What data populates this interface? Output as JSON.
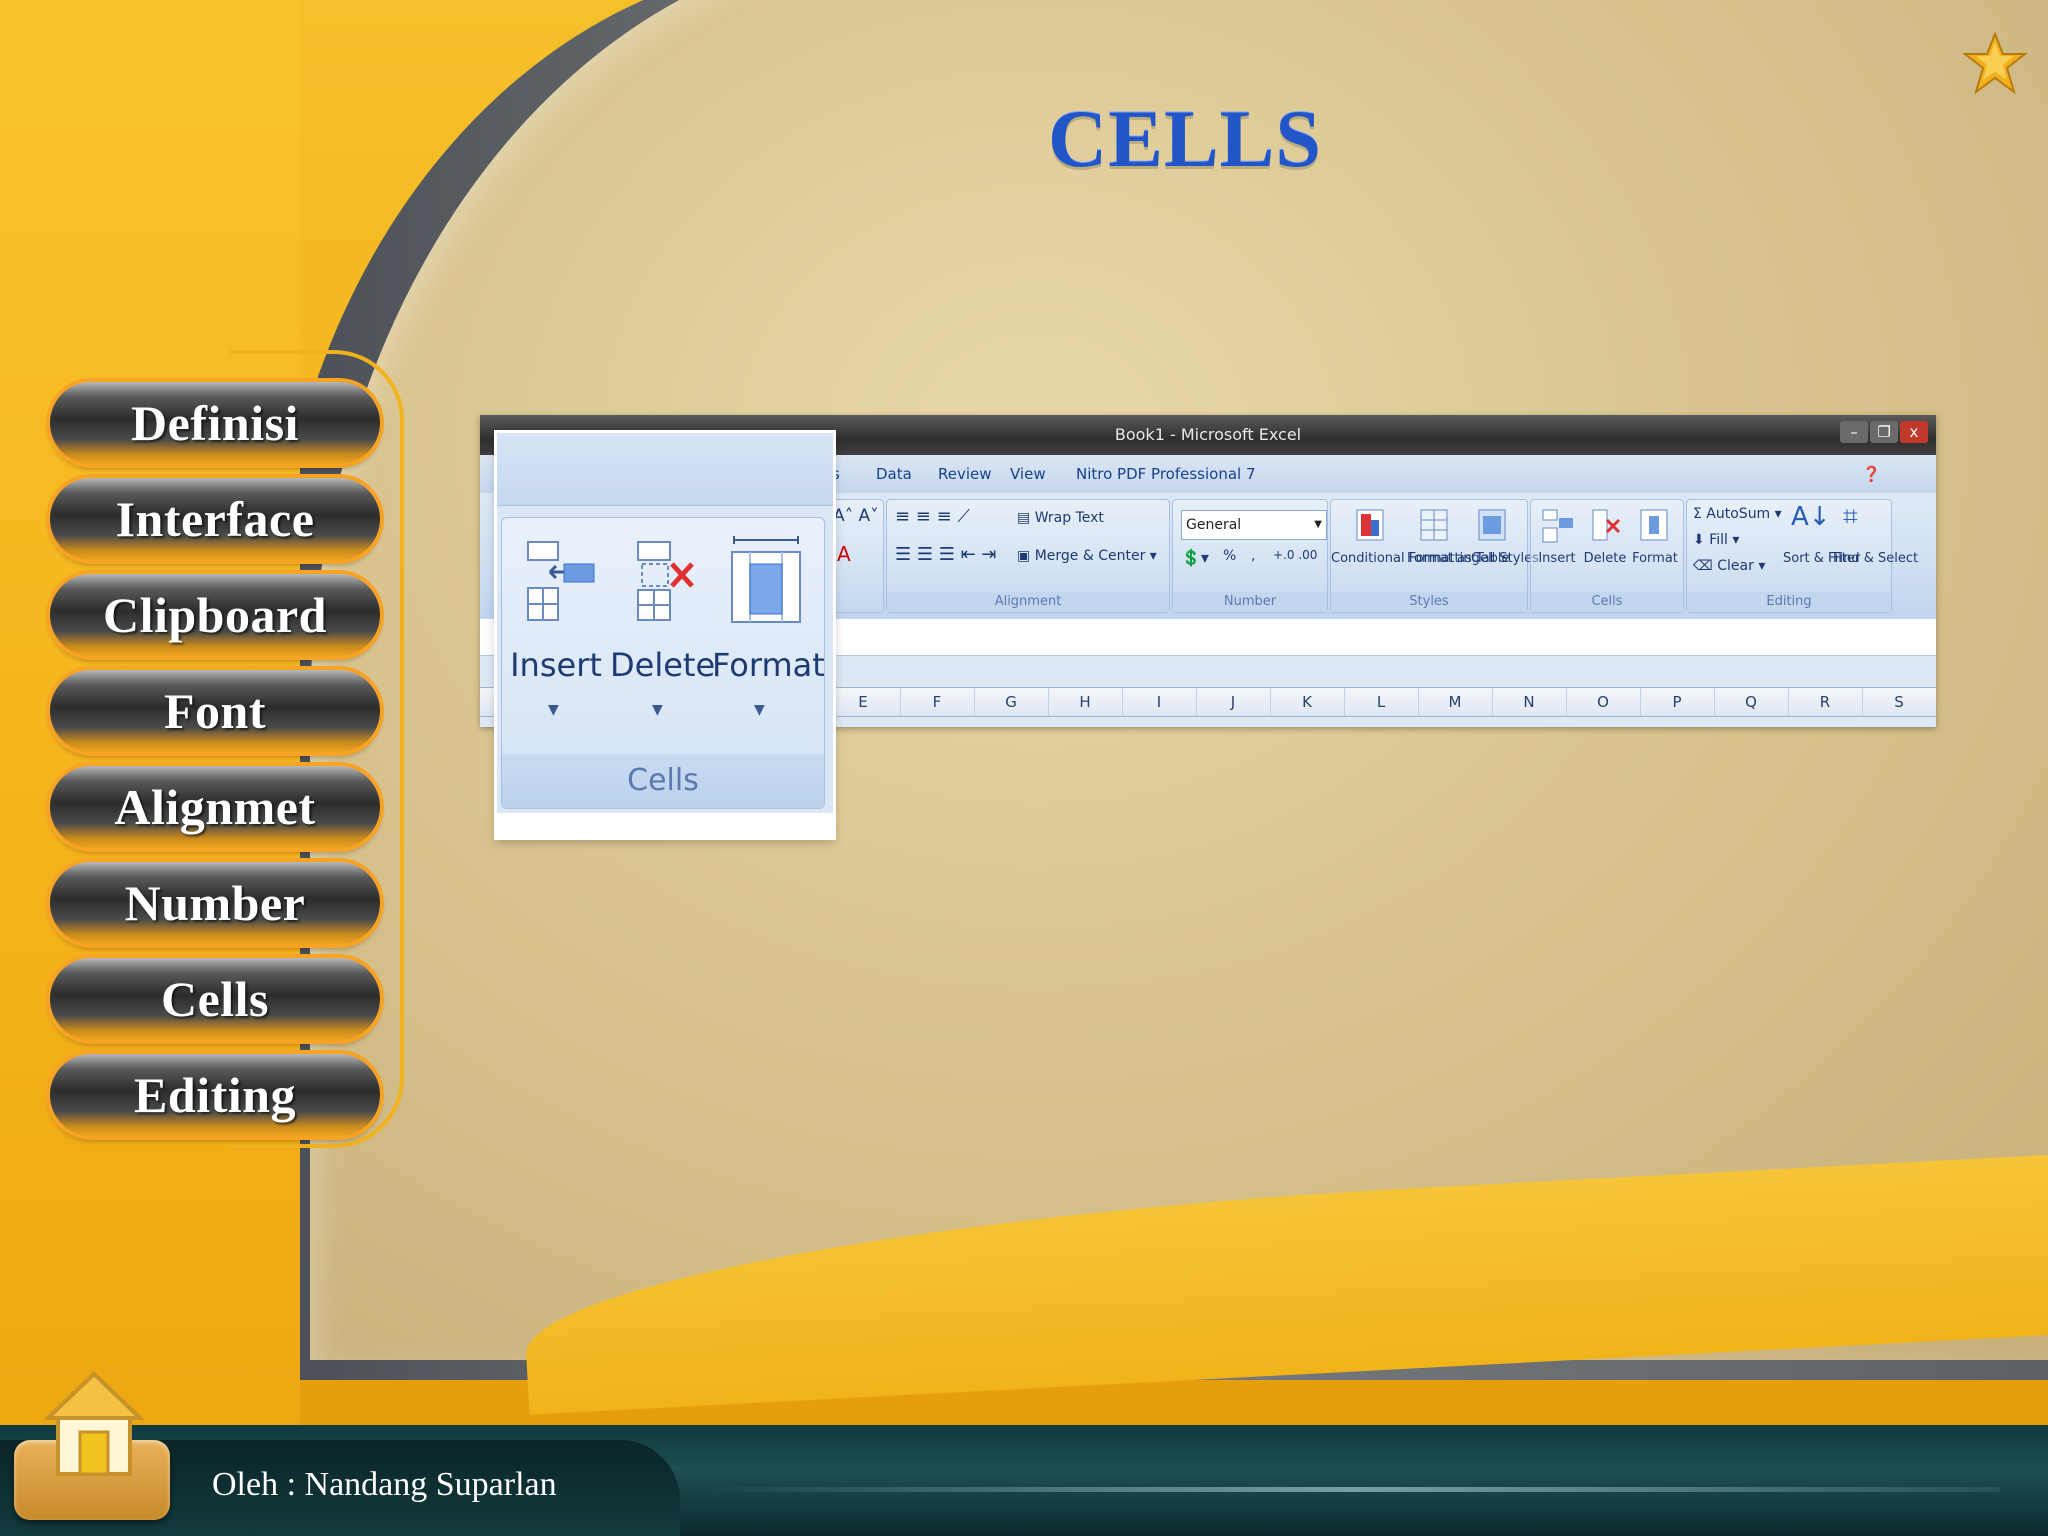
{
  "slide": {
    "title": "CELLS",
    "author": "Oleh : Nandang Suparlan"
  },
  "nav": {
    "items": [
      {
        "label": "Definisi"
      },
      {
        "label": "Interface"
      },
      {
        "label": "Clipboard"
      },
      {
        "label": "Font"
      },
      {
        "label": "Alignmet"
      },
      {
        "label": "Number"
      },
      {
        "label": "Cells"
      },
      {
        "label": "Editing"
      }
    ]
  },
  "excel": {
    "window_title": "Book1 - Microsoft Excel",
    "tabs": [
      "s",
      "Data",
      "Review",
      "View",
      "Nitro PDF Professional 7"
    ],
    "alignment": {
      "wrap_text": "Wrap Text",
      "merge_center": "Merge & Center",
      "group": "Alignment"
    },
    "number": {
      "format": "General",
      "percent": "%",
      "comma": ",",
      "group": "Number"
    },
    "styles": {
      "conditional": "Conditional Formatting",
      "format_table": "Format as Table",
      "cell_styles": "Cell Styles",
      "group": "Styles"
    },
    "cells": {
      "insert": "Insert",
      "delete": "Delete",
      "format": "Format",
      "group": "Cells"
    },
    "editing": {
      "autosum": "AutoSum",
      "fill": "Fill",
      "clear": "Clear",
      "sort_filter": "Sort & Filter",
      "find_select": "Find & Select",
      "group": "Editing"
    },
    "columns": [
      "E",
      "F",
      "G",
      "H",
      "I",
      "J",
      "K",
      "L",
      "M",
      "N",
      "O",
      "P",
      "Q",
      "R",
      "S"
    ]
  },
  "zoom": {
    "insert": "Insert",
    "delete": "Delete",
    "format": "Format",
    "group": "Cells"
  },
  "colors": {
    "title": "#2256c8",
    "accent_yellow": "#f5b21a",
    "panel": "#d9c48f",
    "footer": "#133a3d"
  }
}
